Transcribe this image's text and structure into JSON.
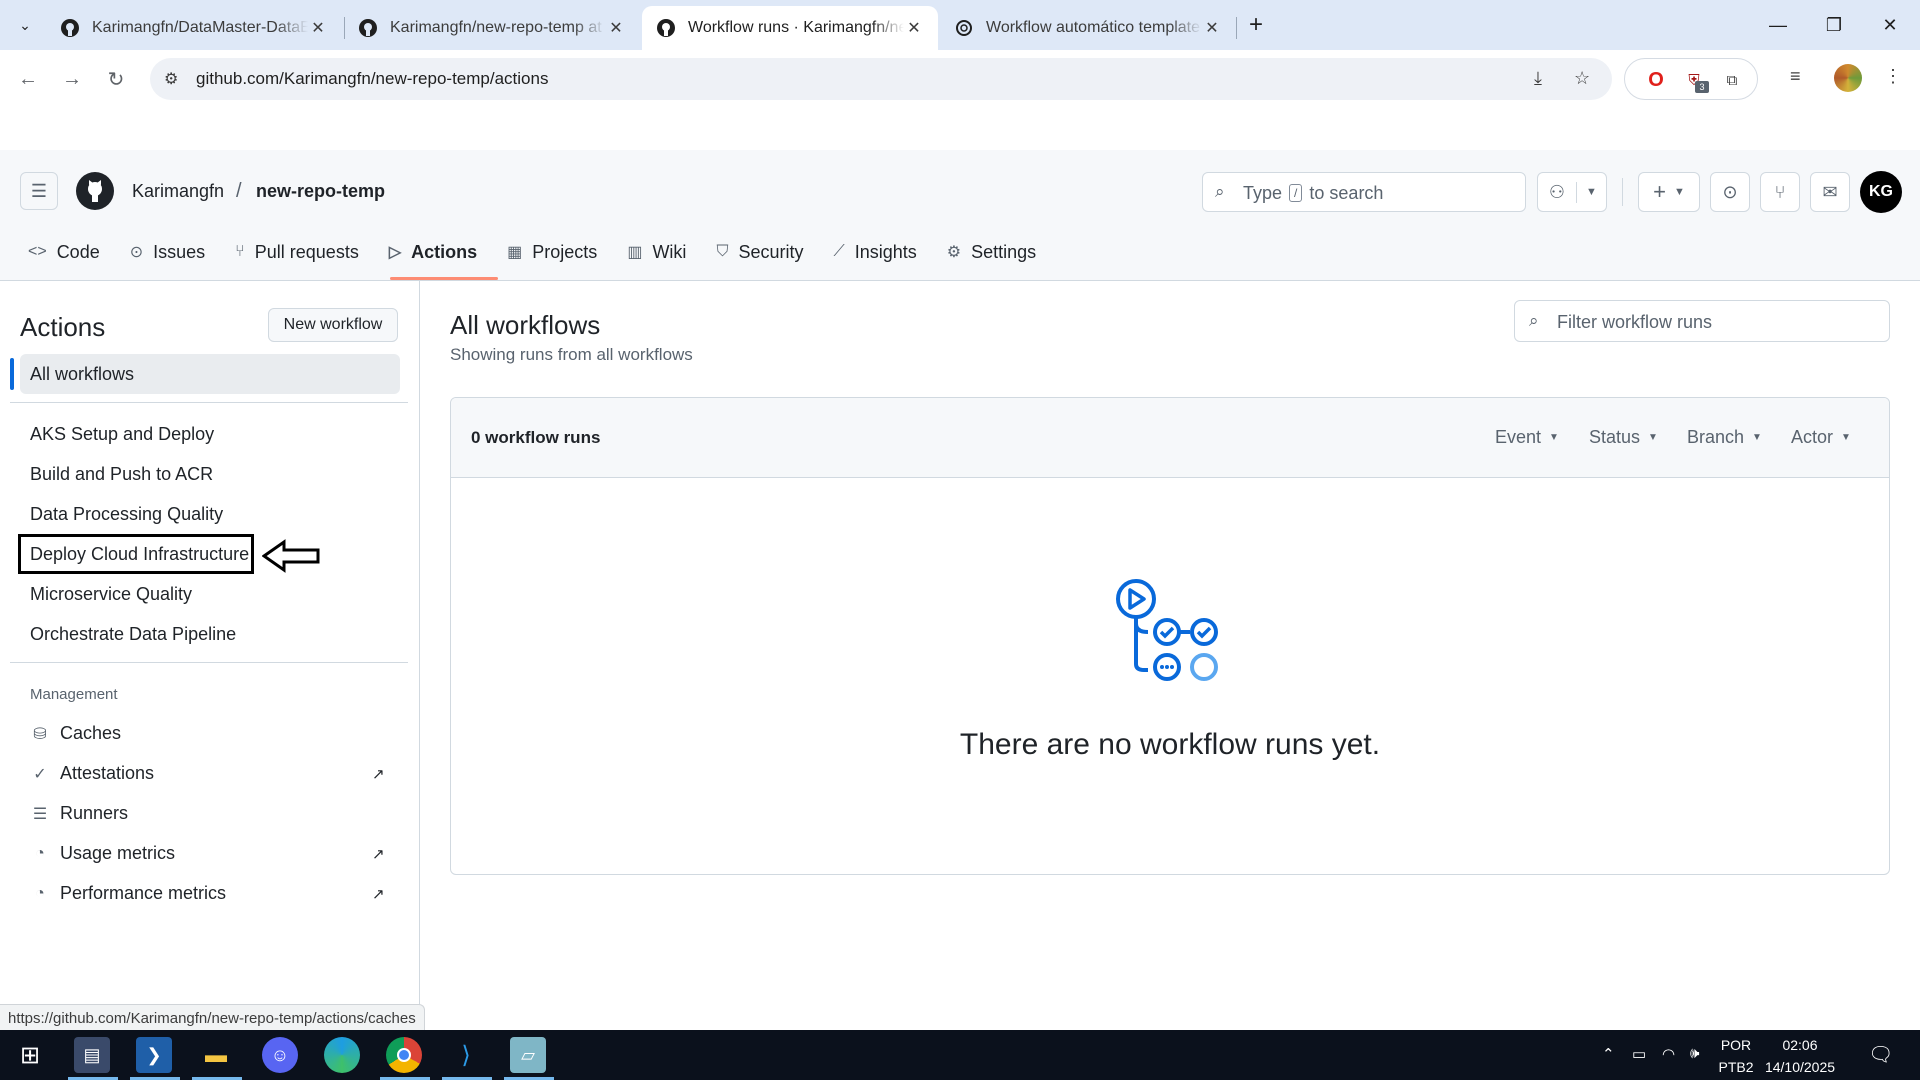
{
  "browser": {
    "tabs": [
      {
        "title": "Karimangfn/DataMaster-DataEr",
        "active": false
      },
      {
        "title": "Karimangfn/new-repo-temp at",
        "active": false
      },
      {
        "title": "Workflow runs · Karimangfn/ne",
        "active": true
      },
      {
        "title": "Workflow automático template",
        "active": false
      }
    ],
    "url": "github.com/Karimangfn/new-repo-temp/actions",
    "extension_badge": "3"
  },
  "header": {
    "owner": "Karimangfn",
    "separator": "/",
    "repo": "new-repo-temp",
    "search_prefix": "Type",
    "search_key": "/",
    "search_suffix": "to search",
    "avatar_initials": "KG"
  },
  "repo_nav": [
    {
      "label": "Code",
      "icon": "code-icon"
    },
    {
      "label": "Issues",
      "icon": "issue-icon"
    },
    {
      "label": "Pull requests",
      "icon": "pull-request-icon"
    },
    {
      "label": "Actions",
      "icon": "play-icon",
      "active": true
    },
    {
      "label": "Projects",
      "icon": "table-icon"
    },
    {
      "label": "Wiki",
      "icon": "book-icon"
    },
    {
      "label": "Security",
      "icon": "shield-icon"
    },
    {
      "label": "Insights",
      "icon": "graph-icon"
    },
    {
      "label": "Settings",
      "icon": "gear-icon"
    }
  ],
  "sidebar": {
    "title": "Actions",
    "new_workflow": "New workflow",
    "all_workflows": "All workflows",
    "workflows": [
      "AKS Setup and Deploy",
      "Build and Push to ACR",
      "Data Processing Quality",
      "Deploy Cloud Infrastructure",
      "Microservice Quality",
      "Orchestrate Data Pipeline"
    ],
    "management_label": "Management",
    "management": [
      {
        "label": "Caches",
        "icon": "database-icon",
        "external": false
      },
      {
        "label": "Attestations",
        "icon": "verified-icon",
        "external": true
      },
      {
        "label": "Runners",
        "icon": "server-icon",
        "external": false
      },
      {
        "label": "Usage metrics",
        "icon": "meter-icon",
        "external": true
      },
      {
        "label": "Performance metrics",
        "icon": "meter-icon",
        "external": true
      }
    ]
  },
  "main": {
    "title": "All workflows",
    "subtitle": "Showing runs from all workflows",
    "filter_placeholder": "Filter workflow runs",
    "run_count": "0 workflow runs",
    "filters": [
      "Event",
      "Status",
      "Branch",
      "Actor"
    ],
    "empty_message": "There are no workflow runs yet."
  },
  "status_url": "https://github.com/Karimangfn/new-repo-temp/actions/caches",
  "taskbar": {
    "language": "POR",
    "layout": "PTB2",
    "time": "02:06",
    "date": "14/10/2025"
  }
}
